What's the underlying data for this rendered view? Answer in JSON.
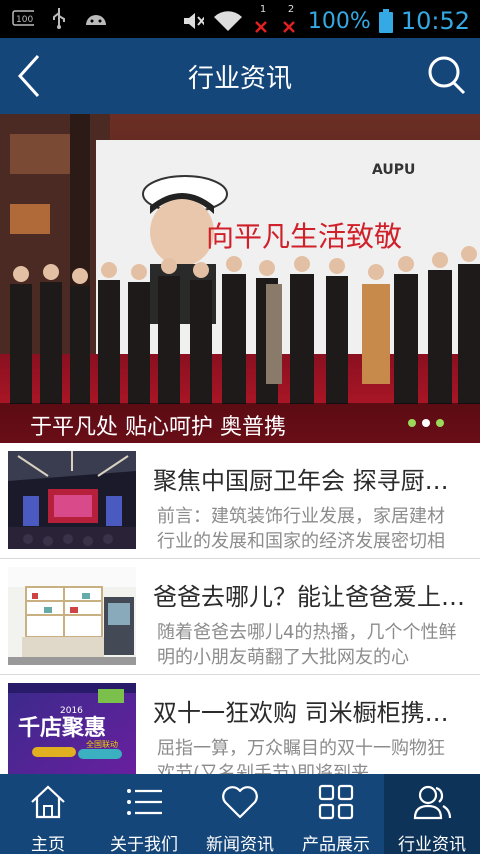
{
  "status_bar": {
    "icons": [
      "usb-100-icon",
      "usb-icon",
      "android-icon",
      "mute-icon",
      "wifi-icon",
      "sim1-no-signal-icon",
      "sim2-no-signal-icon",
      "battery-icon"
    ],
    "sim1_label": "1",
    "sim2_label": "2",
    "battery_percent": "100%",
    "time": "10:52"
  },
  "app_bar": {
    "title": "行业资讯"
  },
  "banner": {
    "caption": "于平凡处 贴心呵护 奥普携",
    "stage_slogan": "向平凡生活致敬",
    "brand": "AUPU",
    "slides": 3,
    "active_slide": 2
  },
  "news": [
    {
      "title": "聚焦中国厨卫年会 探寻厨卫行业发展",
      "desc": "前言：建筑装饰行业发展，家居建材行业的发展和国家的经济发展密切相关"
    },
    {
      "title": "爸爸去哪儿？能让爸爸爱上厨房的地方",
      "desc": "随着爸爸去哪儿4的热播，几个个性鲜明的小朋友萌翻了大批网友的心"
    },
    {
      "title": "双十一狂欢购 司米橱柜携手天猫",
      "desc": "屈指一算，万众瞩目的双十一购物狂欢节(又名剁手节)即将到来"
    }
  ],
  "thumb3_text": {
    "year": "2016",
    "headline": "千店聚惠",
    "sub": "全国联动"
  },
  "tabs": [
    {
      "label": "主页",
      "icon": "home-icon"
    },
    {
      "label": "关于我们",
      "icon": "list-icon"
    },
    {
      "label": "新闻资讯",
      "icon": "heart-icon"
    },
    {
      "label": "产品展示",
      "icon": "grid-icon"
    },
    {
      "label": "行业资讯",
      "icon": "users-icon"
    }
  ],
  "active_tab": 4,
  "colors": {
    "app_bar": "#15467a",
    "tab_active": "#0d3359",
    "status_accent": "#34a9e3"
  }
}
